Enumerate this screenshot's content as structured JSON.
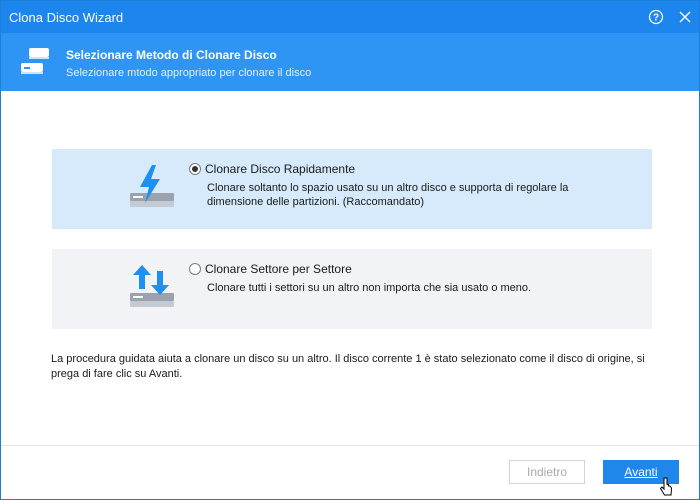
{
  "window": {
    "title": "Clona Disco Wizard",
    "help_glyph": "?",
    "close_glyph": "✕"
  },
  "header": {
    "title": "Selezionare Metodo di Clonare Disco",
    "subtitle": "Selezionare mtodo appropriato per clonare il disco",
    "icon": "disks-icon"
  },
  "options": [
    {
      "label": "Clonare Disco Rapidamente",
      "description": "Clonare soltanto lo spazio usato su un altro disco e supporta di regolare la dimensione delle partizioni. (Raccomandato)",
      "selected": true,
      "icon": "lightning-disk-icon"
    },
    {
      "label": "Clonare Settore per Settore",
      "description": "Clonare tutti i settori su un altro non importa che sia usato o meno.",
      "selected": false,
      "icon": "arrows-disk-icon"
    }
  ],
  "info_text": "La procedura guidata aiuta a clonare un disco su un altro. Il disco corrente 1 è stato selezionato come il disco di origine, si prega di fare clic su Avanti.",
  "buttons": {
    "back_label": "Indietro",
    "next_label": "Avanti"
  },
  "colors": {
    "titlebar": "#1c86ee",
    "header": "#2e95f5",
    "selected_option_bg": "#d6eafb",
    "option_bg": "#f1f3f6",
    "primary_button": "#1f86ec",
    "icon_blue": "#1f8ff0",
    "icon_gray": "#9aa3ad"
  }
}
